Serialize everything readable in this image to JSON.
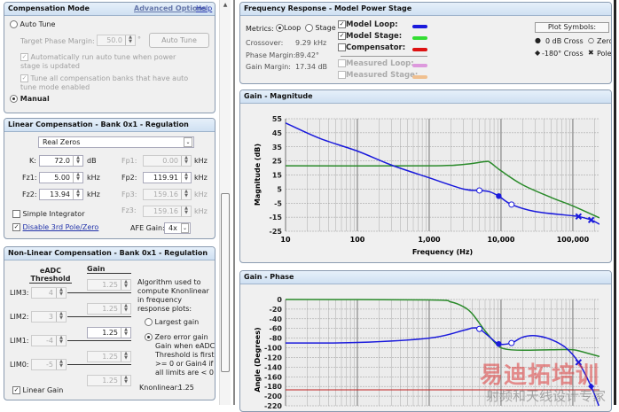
{
  "comp_mode": {
    "title": "Compensation Mode",
    "advanced": "Advanced Options",
    "help": "Help",
    "auto_tune": "Auto Tune",
    "target_pm_label": "Target Phase Margin:",
    "target_pm": "50.0",
    "deg": "°",
    "auto_tune_btn": "Auto Tune",
    "auto_run": "Automatically run auto tune when power stage is updated",
    "tune_all": "Tune all compensation banks that have auto tune mode enabled",
    "manual": "Manual"
  },
  "linear": {
    "title": "Linear Compensation - Bank 0x1 - Regulation",
    "mode": "Real Zeros",
    "k_label": "K:",
    "k": "72.0",
    "k_unit": "dB",
    "fz1_label": "Fz1:",
    "fz1": "5.00",
    "fz2_label": "Fz2:",
    "fz2": "13.94",
    "khz": "kHz",
    "fp1_label": "Fp1:",
    "fp1": "0.00",
    "fp2_label": "Fp2:",
    "fp2": "119.91",
    "fp3_label": "Fp3:",
    "fp3": "159.16",
    "fz3_label": "Fz3:",
    "fz3": "159.16",
    "simple_integrator": "Simple Integrator",
    "disable_3rd": "Disable 3rd Pole/Zero",
    "afe_label": "AFE Gain:",
    "afe": "4x"
  },
  "nonlinear": {
    "title": "Non-Linear Compensation - Bank 0x1 - Regulation",
    "thr_head": "eADC Threshold",
    "gain_head": "Gain",
    "lims": [
      {
        "label": "LIM3:",
        "value": "4"
      },
      {
        "label": "LIM2:",
        "value": "3"
      },
      {
        "label": "LIM1:",
        "value": "-4"
      },
      {
        "label": "LIM0:",
        "value": "-5"
      }
    ],
    "gains": [
      "1.25",
      "1.25",
      "1.25",
      "1.25",
      "1.25"
    ],
    "algo": "Algorithm used to compute Knonlinear in frequency response plots:",
    "largest": "Largest gain",
    "zero_err": "Zero error gain",
    "zero_desc": "Gain when eADC Threshold is first >= 0 or Gain4 if all limits are < 0",
    "knl_label": "Knonlinear:",
    "knl": "1.25",
    "linear_gain": "Linear Gain"
  },
  "freq": {
    "title": "Frequency Response - Model Power Stage",
    "metrics": "Metrics:",
    "loop": "Loop",
    "stage": "Stage",
    "crossover_label": "Crossover:",
    "crossover": "9.29 kHz",
    "pm_label": "Phase Margin:",
    "pm": "89.42°",
    "gm_label": "Gain Margin:",
    "gm": "17.34 dB",
    "legend": [
      {
        "label": "Model Loop:",
        "color": "#1a1adc",
        "checked": true,
        "enabled": true
      },
      {
        "label": "Model Stage:",
        "color": "#33dd33",
        "checked": true,
        "enabled": true
      },
      {
        "label": "Compensator:",
        "color": "#dd1111",
        "checked": false,
        "enabled": true
      },
      {
        "label": "Measured Loop:",
        "color": "#dd99dd",
        "checked": false,
        "enabled": false
      },
      {
        "label": "Measured Stage:",
        "color": "#f0c090",
        "checked": false,
        "enabled": false
      }
    ],
    "plot_symbols": "Plot Symbols:",
    "sym_0db": "0 dB Cross",
    "sym_zero": "Zero",
    "sym_180": "-180° Cross",
    "sym_pole": "Pole"
  },
  "watermark": {
    "main": "易迪拓培训",
    "sub": "射频和天线设计专家"
  },
  "chart_data": [
    {
      "type": "line",
      "title": "Gain - Magnitude",
      "xlabel": "Frequency (Hz)",
      "ylabel": "Magnitude (dB)",
      "xscale": "log",
      "xlim": [
        10,
        235000
      ],
      "ylim": [
        -25,
        55
      ],
      "xticks": [
        {
          "v": 10,
          "l": "10"
        },
        {
          "v": 100,
          "l": "100"
        },
        {
          "v": 1000,
          "l": "1,000"
        },
        {
          "v": 10000,
          "l": "10,000"
        },
        {
          "v": 100000,
          "l": "100,000"
        }
      ],
      "yticks": [
        55,
        45,
        35,
        25,
        15,
        5,
        -5,
        -15,
        -25
      ],
      "series": [
        {
          "name": "Model Loop",
          "color": "#1a1adc",
          "points": [
            [
              10,
              52
            ],
            [
              30,
              41
            ],
            [
              100,
              32
            ],
            [
              300,
              22
            ],
            [
              1000,
              13
            ],
            [
              3000,
              5
            ],
            [
              5000,
              4
            ],
            [
              7000,
              3
            ],
            [
              9300,
              0
            ],
            [
              14000,
              -6
            ],
            [
              30000,
              -11
            ],
            [
              100000,
              -14
            ],
            [
              120000,
              -14.5
            ],
            [
              180000,
              -17
            ],
            [
              235000,
              -20
            ]
          ]
        },
        {
          "name": "Model Stage",
          "color": "#2a8a2a",
          "points": [
            [
              10,
              21.5
            ],
            [
              1000,
              21.5
            ],
            [
              3000,
              22.5
            ],
            [
              6000,
              24.5
            ],
            [
              7000,
              24
            ],
            [
              10000,
              18
            ],
            [
              20000,
              8
            ],
            [
              50000,
              -1
            ],
            [
              100000,
              -7
            ],
            [
              235000,
              -15.5
            ]
          ]
        }
      ],
      "markers": [
        {
          "kind": "zero",
          "x": 5000,
          "y": 4
        },
        {
          "kind": "zero",
          "x": 14000,
          "y": -6
        },
        {
          "kind": "cross0",
          "x": 9300,
          "y": 0
        },
        {
          "kind": "pole",
          "x": 120000,
          "y": -14.5
        },
        {
          "kind": "pole",
          "x": 180000,
          "y": -17
        }
      ]
    },
    {
      "type": "line",
      "title": "Gain - Phase",
      "xlabel": "Frequency (Hz)",
      "ylabel": "Angle (Degrees)",
      "xscale": "log",
      "xlim": [
        10,
        235000
      ],
      "ylim": [
        -220,
        0
      ],
      "yticks": [
        0,
        -20,
        -40,
        -60,
        -80,
        -100,
        -120,
        -140,
        -160,
        -180,
        -200,
        -220
      ],
      "ref_line": -187,
      "series": [
        {
          "name": "Model Loop",
          "color": "#1a1adc",
          "points": [
            [
              10,
              -90
            ],
            [
              100,
              -89
            ],
            [
              1000,
              -80
            ],
            [
              3000,
              -64
            ],
            [
              4000,
              -59
            ],
            [
              5000,
              -61
            ],
            [
              7000,
              -78
            ],
            [
              9300,
              -92
            ],
            [
              14000,
              -90
            ],
            [
              20000,
              -78
            ],
            [
              30000,
              -75
            ],
            [
              50000,
              -83
            ],
            [
              80000,
              -100
            ],
            [
              120000,
              -130
            ],
            [
              180000,
              -180
            ],
            [
              230000,
              -220
            ]
          ]
        },
        {
          "name": "Model Stage",
          "color": "#2a8a2a",
          "points": [
            [
              10,
              0
            ],
            [
              1000,
              -1
            ],
            [
              2000,
              -5
            ],
            [
              3000,
              -15
            ],
            [
              4000,
              -30
            ],
            [
              6000,
              -65
            ],
            [
              9000,
              -95
            ],
            [
              12000,
              -103
            ],
            [
              20000,
              -105
            ],
            [
              50000,
              -104
            ],
            [
              100000,
              -104
            ],
            [
              150000,
              -110
            ],
            [
              235000,
              -118
            ]
          ]
        }
      ],
      "markers": [
        {
          "kind": "zero",
          "x": 5000,
          "y": -61
        },
        {
          "kind": "zero",
          "x": 14000,
          "y": -90
        },
        {
          "kind": "cross0",
          "x": 9300,
          "y": -92
        },
        {
          "kind": "pole",
          "x": 120000,
          "y": -130
        },
        {
          "kind": "cross180",
          "x": 180000,
          "y": -180
        }
      ]
    }
  ]
}
